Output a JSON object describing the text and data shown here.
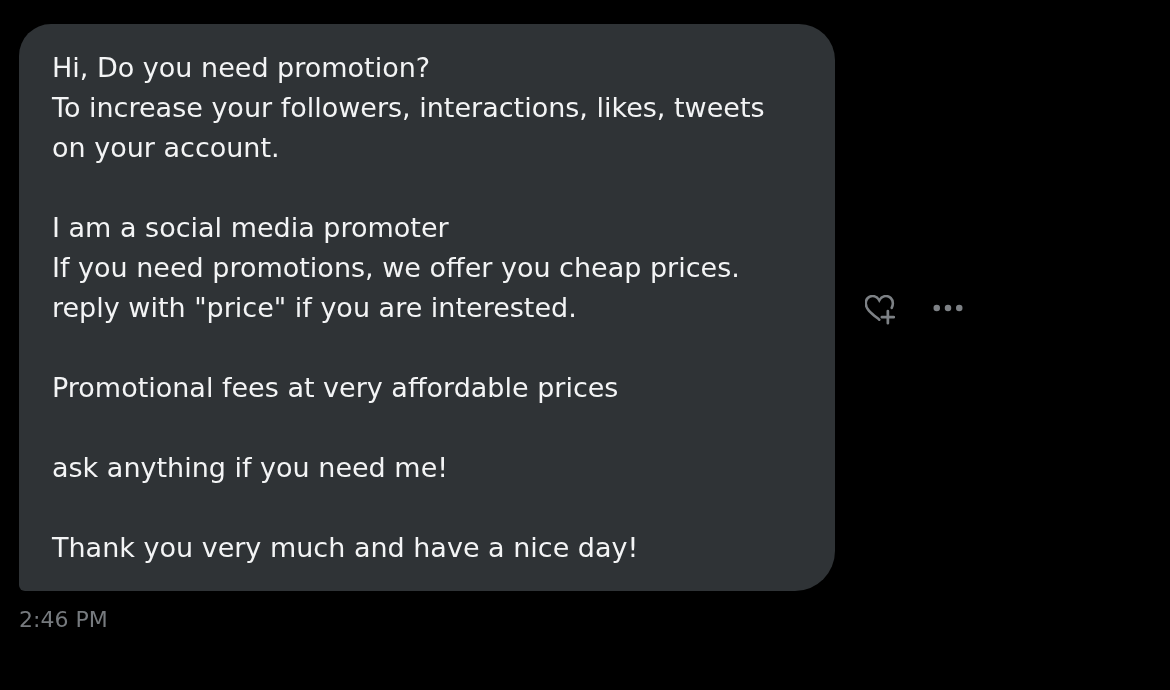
{
  "message": {
    "paragraphs": [
      {
        "lines": [
          "Hi, Do you need promotion?",
          "To increase your followers, interactions, likes, tweets",
          "on your account."
        ]
      },
      {
        "lines": [
          "I am a social media promoter",
          "If you need promotions, we offer you cheap prices.",
          "reply with \"price\" if you are interested."
        ]
      },
      {
        "lines": [
          "Promotional fees at very affordable prices"
        ]
      },
      {
        "lines": [
          "ask anything if you need me!"
        ]
      },
      {
        "lines": [
          "Thank you very much and have a nice day!"
        ]
      }
    ],
    "time": "2:46 PM"
  }
}
